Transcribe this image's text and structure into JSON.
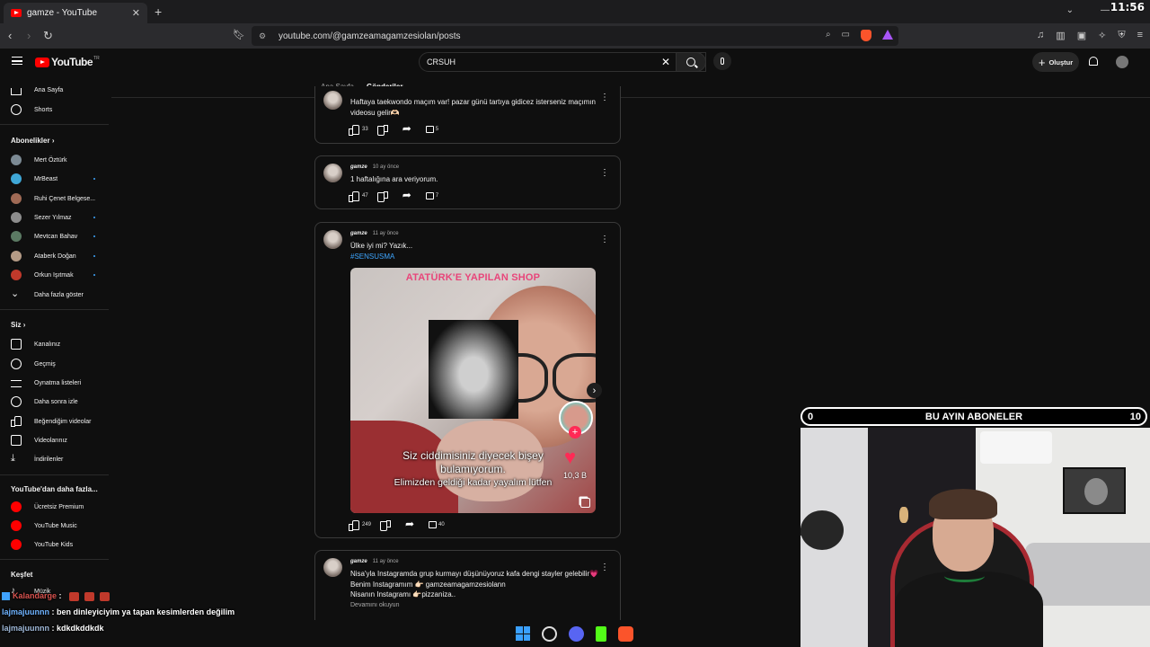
{
  "browser": {
    "tab_title": "gamze - YouTube",
    "new_tab": "+",
    "url": "youtube.com/@gamzeamagamzesiolan/posts",
    "clock": "11:56"
  },
  "header": {
    "logo": "YouTube",
    "logo_region": "TR",
    "search_value": "CRSUH",
    "create_label": "Oluştur"
  },
  "sidebar": {
    "main": [
      {
        "label": "Ana Sayfa",
        "icon": "home-icon"
      },
      {
        "label": "Shorts",
        "icon": "shorts-icon"
      }
    ],
    "subscriptions_title": "Abonelikler",
    "subscriptions": [
      {
        "label": "Mert Öztürk",
        "dot": false
      },
      {
        "label": "MrBeast",
        "dot": true
      },
      {
        "label": "Ruhi Çenet Belgese...",
        "dot": false
      },
      {
        "label": "Sezer Yılmaz",
        "dot": true
      },
      {
        "label": "Mevtcan Bahav",
        "dot": true
      },
      {
        "label": "Ataberk Doğan",
        "dot": true
      },
      {
        "label": "Orkun Işıtmak",
        "dot": true
      }
    ],
    "show_more": "Daha fazla göster",
    "you_title": "Siz",
    "you": [
      {
        "label": "Kanalınız",
        "icon": "channel-icon"
      },
      {
        "label": "Geçmiş",
        "icon": "history-icon"
      },
      {
        "label": "Oynatma listeleri",
        "icon": "playlist-icon"
      },
      {
        "label": "Daha sonra izle",
        "icon": "watch-later-icon"
      },
      {
        "label": "Beğendiğim videolar",
        "icon": "liked-icon"
      },
      {
        "label": "Videolarınız",
        "icon": "your-videos-icon"
      },
      {
        "label": "İndirilenler",
        "icon": "download-icon"
      }
    ],
    "more_title": "YouTube'dan daha fazla...",
    "more": [
      {
        "label": "Ücretsiz Premium"
      },
      {
        "label": "YouTube Music"
      },
      {
        "label": "YouTube Kids"
      }
    ],
    "explore_title": "Keşfet",
    "explore": [
      {
        "label": "Müzik"
      }
    ]
  },
  "channel_tabs": [
    "Ana Sayfa",
    "Gönderiler"
  ],
  "posts": [
    {
      "text": "Haftaya taekwondo maçım var! pazar günü tartıya gidicez isterseniz maçımın videosu gelir🫶🏻",
      "likes": "33",
      "comments": "5"
    },
    {
      "author": "gamze",
      "time": "10 ay önce",
      "text": "1 haftalığına ara veriyorum.",
      "likes": "47",
      "comments": "7"
    },
    {
      "author": "gamze",
      "time": "11 ay önce",
      "text": "Ülke iyi mi? Yazık...",
      "hashtag": "#SENSUSMA",
      "image": {
        "caption_top": "ATATÜRK'E YAPILAN SHOP",
        "caption_line1": "Siz ciddimisiniz diyecek bişey",
        "caption_line2": "bulamıyorum.",
        "caption_line3": "Elimizden geldiği kadar yayalım lütfen",
        "heart_count": "10,3 B"
      },
      "likes": "249",
      "comments": "40"
    },
    {
      "author": "gamze",
      "time": "11 ay önce",
      "line1": "Nisa'yla Instagramda grup kurmayı düşünüyoruz kafa dengi stayler gelebilir💗",
      "line2": "Benim Instagramım 👉🏻 gamzeamagamzesiolann",
      "line3": "Nisanın Instagramı 👉🏻pizzaniza..",
      "read_more": "Devamını okuyun"
    }
  ],
  "overlay": {
    "left_count": "0",
    "title": "BU AYIN ABONELER",
    "right_count": "10"
  },
  "chat": [
    {
      "user": "Kalandarge",
      "message": ""
    },
    {
      "user": "lajmajuunnn",
      "message": "ben dinleyiciyim ya tapan kesimlerden değilim"
    },
    {
      "user": "lajmajuunnn",
      "message": "kdkdkddkdk"
    }
  ],
  "colors": {
    "youtube_red": "#ff0000",
    "link_blue": "#3ea6ff",
    "background": "#0f0f0f"
  }
}
